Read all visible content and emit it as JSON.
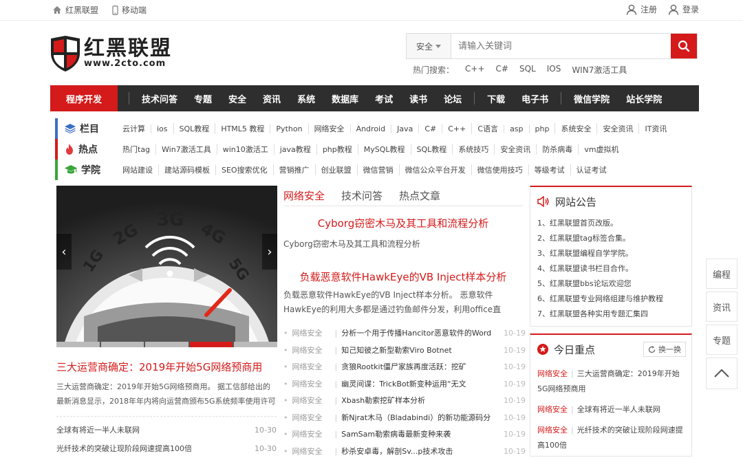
{
  "topbar": {
    "home_label": "红黑联盟",
    "mobile_label": "移动端",
    "register_label": "注册",
    "login_label": "登录"
  },
  "logo": {
    "cn": "红黑联盟",
    "en": "www.2cto.com"
  },
  "search": {
    "category": "安全",
    "placeholder": "请输入关键词",
    "hot_label": "热门搜索：",
    "hot_terms": [
      "C++",
      "C#",
      "SQL",
      "IOS",
      "WIN7激活工具"
    ]
  },
  "nav": {
    "first": "程序开发",
    "group1": [
      "技术问答",
      "专题",
      "安全",
      "资讯",
      "系统",
      "数据库",
      "考试",
      "读书",
      "论坛"
    ],
    "group2": [
      "下载",
      "电子书"
    ],
    "group3": [
      "微信学院",
      "站长学院"
    ]
  },
  "cat_rows": [
    {
      "title": "栏目",
      "links": [
        "云计算",
        "ios",
        "SQL教程",
        "HTML5 教程",
        "Python",
        "网络安全",
        "Android",
        "Java",
        "C#",
        "C++",
        "C语言",
        "asp",
        "php",
        "系统安全",
        "安全资讯",
        "IT资讯"
      ]
    },
    {
      "title": "热点",
      "links": [
        "热门tag",
        "Win7激活工具",
        "win10激活工",
        "java教程",
        "php教程",
        "MySQL教程",
        "SQL教程",
        "系统技巧",
        "安全资讯",
        "防杀病毒",
        "vm虚拟机"
      ]
    },
    {
      "title": "学院",
      "links": [
        "网站建设",
        "建站源码模板",
        "SEO搜索优化",
        "营销推广",
        "创业联盟",
        "微信营销",
        "微信公众平台开发",
        "微信使用技巧",
        "等级考试",
        "认证考试"
      ]
    }
  ],
  "slider": {
    "labels": [
      "1G",
      "2G",
      "3G",
      "4G",
      "5G"
    ]
  },
  "featured": {
    "title": "三大运营商确定：2019年开始5G网络预商用",
    "desc": "三大运营商确定：2019年开始5G网络预商用。 据工信部给出的最新消息显示，2018年年内将向运营商颁布5G系统频率使用许可"
  },
  "left_list": [
    {
      "title": "全球有将近一半人未联网",
      "date": "10-30"
    },
    {
      "title": "光纤技术的突破让现阶段网速提高100倍",
      "date": "10-30"
    }
  ],
  "tabs": [
    "网络安全",
    "技术问答",
    "热点文章"
  ],
  "articles": [
    {
      "title": "Cyborg窃密木马及其工具和流程分析",
      "desc": "Cyborg窃密木马及其工具和流程分析"
    },
    {
      "title": "负载恶意软件HawkEye的VB Inject样本分析",
      "desc": "负载恶意软件HawkEye的VB Inject样本分析。 恶意软件HawkEye的利用大多都是通过钓鱼邮件分发，利用office直"
    }
  ],
  "mid_list": [
    {
      "tag": "网络安全",
      "title": "分析一个用于传播Hancitor恶意软件的Word",
      "date": "10-19"
    },
    {
      "tag": "网络安全",
      "title": "知己知彼之新型勒索Viro Botnet",
      "date": "10-19"
    },
    {
      "tag": "网络安全",
      "title": "贪狼Rootkit僵尸家族再度活跃：挖矿",
      "date": "10-19"
    },
    {
      "tag": "网络安全",
      "title": "幽灵间谍：TrickBot新变种运用“无文",
      "date": "10-19"
    },
    {
      "tag": "网络安全",
      "title": "Xbash勒索挖矿样本分析",
      "date": "10-19"
    },
    {
      "tag": "网络安全",
      "title": "新Njrat木马（Bladabindi）的新功能源码分",
      "date": "10-19"
    },
    {
      "tag": "网络安全",
      "title": "SamSam勒索病毒最新变种来袭",
      "date": "10-19"
    },
    {
      "tag": "网络安全",
      "title": "秒杀安卓毒，解剖Sv...p技术攻击",
      "date": "10-19"
    }
  ],
  "notice": {
    "title": "网站公告",
    "items": [
      "1、红黑联盟首页改版。",
      "2、红黑联盟tag标签合集。",
      "3、红黑联盟编程自学学院。",
      "4、红黑联盟读书栏目合作。",
      "5、红黑联盟bbs论坛欢迎您",
      "6、红黑联盟专业网络组建与维护教程",
      "7、红黑联盟各种实用专题汇集四"
    ]
  },
  "focus": {
    "title": "今日重点",
    "change": "换一换",
    "items": [
      {
        "tag": "网络安全",
        "title": "三大运营商确定：2019年开始5G网络预商用"
      },
      {
        "tag": "网络安全",
        "title": "全球有将近一半人未联网"
      },
      {
        "tag": "网络安全",
        "title": "光纤技术的突破让现阶段网速提高100倍"
      }
    ]
  },
  "side": [
    "编程",
    "资讯",
    "专题"
  ],
  "colors": {
    "accent": "#d41a1a",
    "nav_bg": "#2e2e2e",
    "bar_blue": "#3a6fc4",
    "bar_red": "#d41a1a",
    "bar_green": "#3aa53a"
  }
}
